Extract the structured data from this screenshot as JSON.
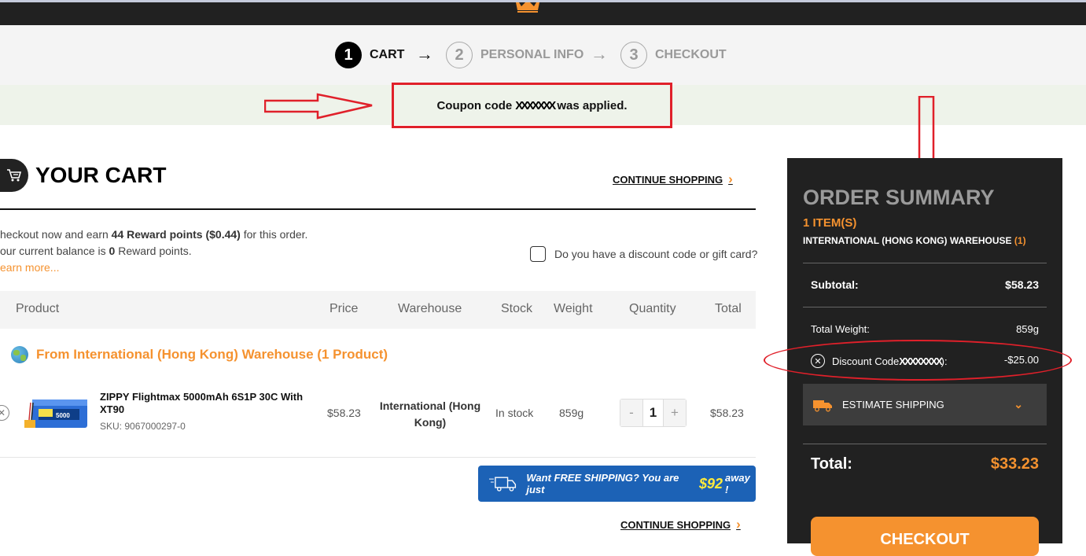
{
  "steps": [
    {
      "num": "1",
      "label": "CART",
      "state": "active"
    },
    {
      "num": "2",
      "label": "PERSONAL INFO",
      "state": "inactive"
    },
    {
      "num": "3",
      "label": "CHECKOUT",
      "state": "inactive"
    }
  ],
  "step_arrow": "→",
  "notice": {
    "prefix": "Coupon code",
    "code": "XXXXXXX",
    "suffix": "was applied."
  },
  "cart": {
    "title": "YOUR CART",
    "continue_label": "CONTINUE SHOPPING",
    "continue_chevron": "›",
    "reward_line1_pre": "heckout now and earn ",
    "reward_line1_bold": "44 Reward points ($0.44)",
    "reward_line1_post": " for this order.",
    "reward_line2_pre": "our current balance is ",
    "reward_line2_bold": "0",
    "reward_line2_post": " Reward points.",
    "learn_more": "earn more...",
    "discount_question": "Do you have a discount code or gift card?"
  },
  "table": {
    "headers": {
      "product": "Product",
      "price": "Price",
      "warehouse": "Warehouse",
      "stock": "Stock",
      "weight": "Weight",
      "quantity": "Quantity",
      "total": "Total"
    },
    "warehouse_group": "From International (Hong Kong) Warehouse (1 Product)",
    "rows": [
      {
        "name": "ZIPPY Flightmax 5000mAh 6S1P 30C With XT90",
        "sku": "SKU: 9067000297-0",
        "price": "$58.23",
        "warehouse": "International (Hong Kong)",
        "stock": "In stock",
        "weight": "859g",
        "qty_minus": "-",
        "quantity": "1",
        "qty_plus": "+",
        "total": "$58.23"
      }
    ]
  },
  "free_shipping": {
    "pre": "Want FREE SHIPPING? You are just",
    "amount": "$92",
    "post": "away !"
  },
  "summary": {
    "title": "ORDER SUMMARY",
    "items": "1 ITEM(S)",
    "warehouse": "INTERNATIONAL (HONG KONG) WAREHOUSE",
    "warehouse_count": "(1)",
    "subtotal_label": "Subtotal:",
    "subtotal_value": "$58.23",
    "weight_label": "Total Weight:",
    "weight_value": "859g",
    "discount_label": "Discount Code",
    "discount_code": "XXXXXXXX",
    "discount_suffix": "):",
    "discount_value": "-$25.00",
    "estimate_shipping": "ESTIMATE SHIPPING",
    "total_label": "Total:",
    "total_value": "$33.23",
    "checkout": "CHECKOUT"
  },
  "colors": {
    "accent": "#f5922f",
    "dark": "#212121",
    "annotation": "#e0202a",
    "banner_blue": "#1c62b6"
  }
}
